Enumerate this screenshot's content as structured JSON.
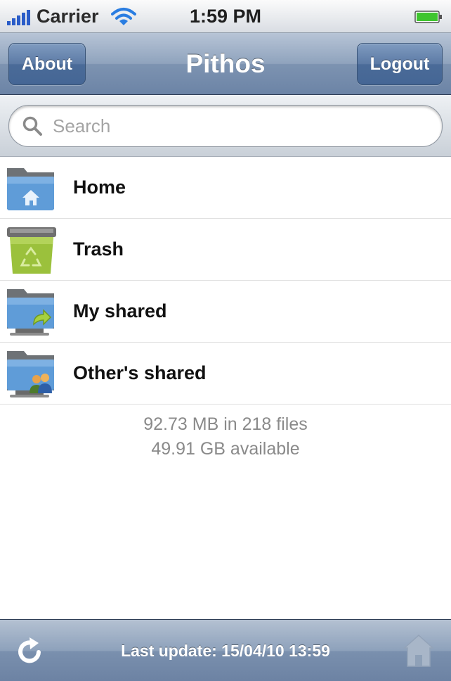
{
  "status_bar": {
    "carrier": "Carrier",
    "time": "1:59 PM",
    "icons": [
      "signal-icon",
      "wifi-icon",
      "battery-icon"
    ]
  },
  "nav_bar": {
    "left_button": "About",
    "title": "Pithos",
    "right_button": "Logout"
  },
  "search": {
    "placeholder": "Search",
    "icon": "search-icon"
  },
  "folders": [
    {
      "label": "Home",
      "icon": "home-folder-icon"
    },
    {
      "label": "Trash",
      "icon": "trash-icon"
    },
    {
      "label": "My shared",
      "icon": "my-shared-folder-icon"
    },
    {
      "label": "Other's shared",
      "icon": "others-shared-folder-icon"
    }
  ],
  "summary": {
    "usage": "92.73 MB in 218 files",
    "available": "49.91 GB available"
  },
  "toolbar": {
    "last_update": "Last update: 15/04/10 13:59",
    "icons": [
      "refresh-icon",
      "home-icon"
    ]
  },
  "colors": {
    "nav_blue": "#6c84a6",
    "button_blue": "#4a6b98",
    "battery_green": "#3fc52f",
    "wifi_blue": "#2a7de1",
    "summary_text": "#8a8a8a"
  }
}
